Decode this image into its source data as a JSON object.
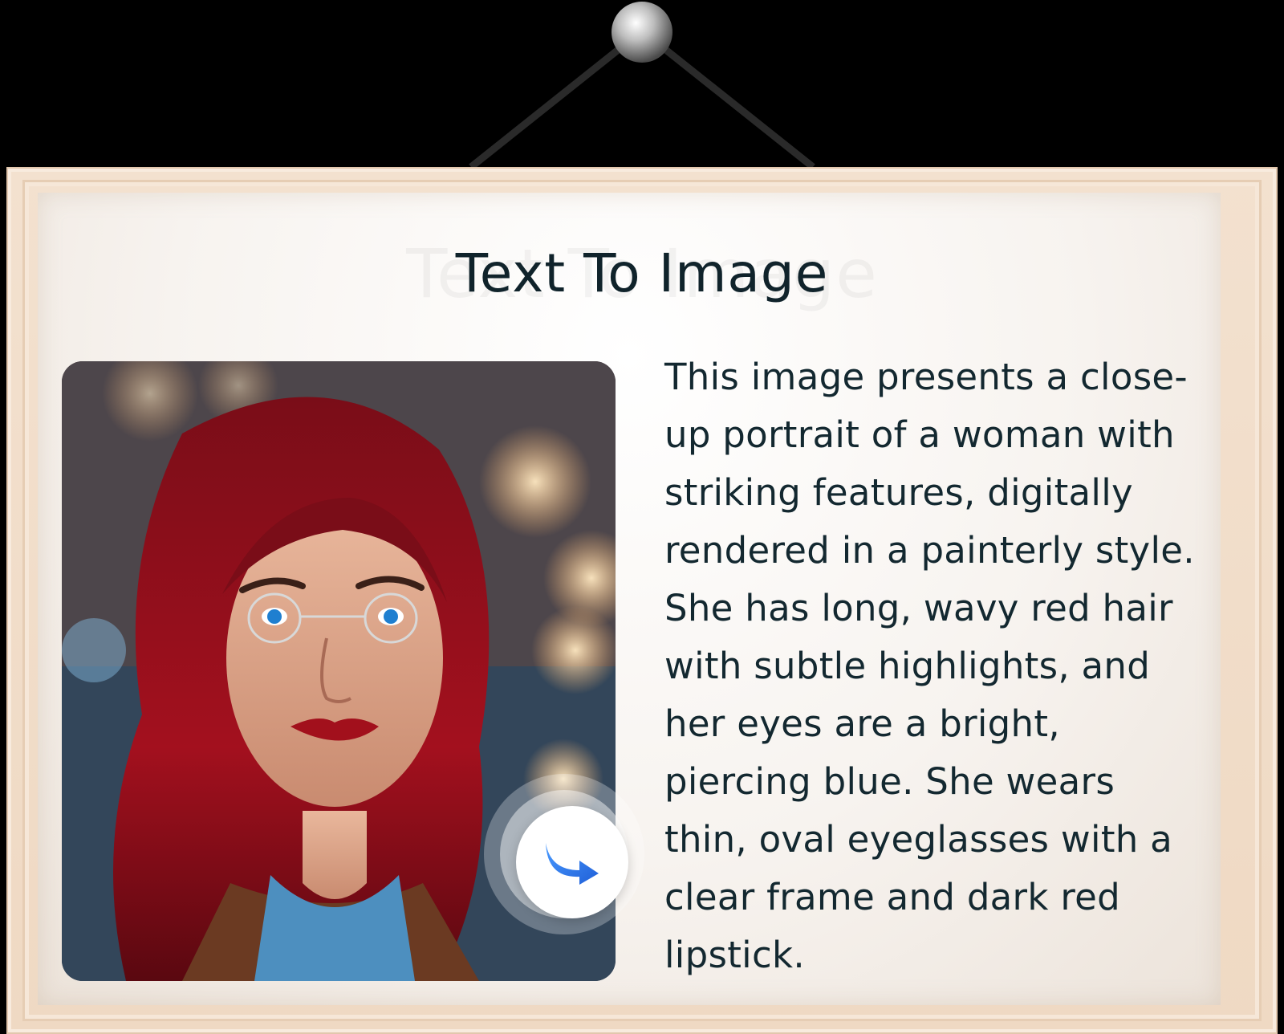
{
  "title": "Text To Image",
  "description": "This image presents a close-\nup portrait of a woman with\nstriking features, digitally\nrendered in a painterly style.\nShe has long, wavy red hair\nwith subtle highlights, and\nher eyes are a bright,\npiercing blue. She wears\nthin, oval eyeglasses with a\nclear frame and dark red\nlipstick.",
  "colors": {
    "background": "#000000",
    "frame": "#f3e1cf",
    "title_text": "#10232b",
    "body_text": "#132830",
    "arrow_icon": "#2f7cf0"
  },
  "icons": {
    "hanger_pin": "pushpin-ball-icon",
    "action": "curved-arrow-right-icon"
  }
}
